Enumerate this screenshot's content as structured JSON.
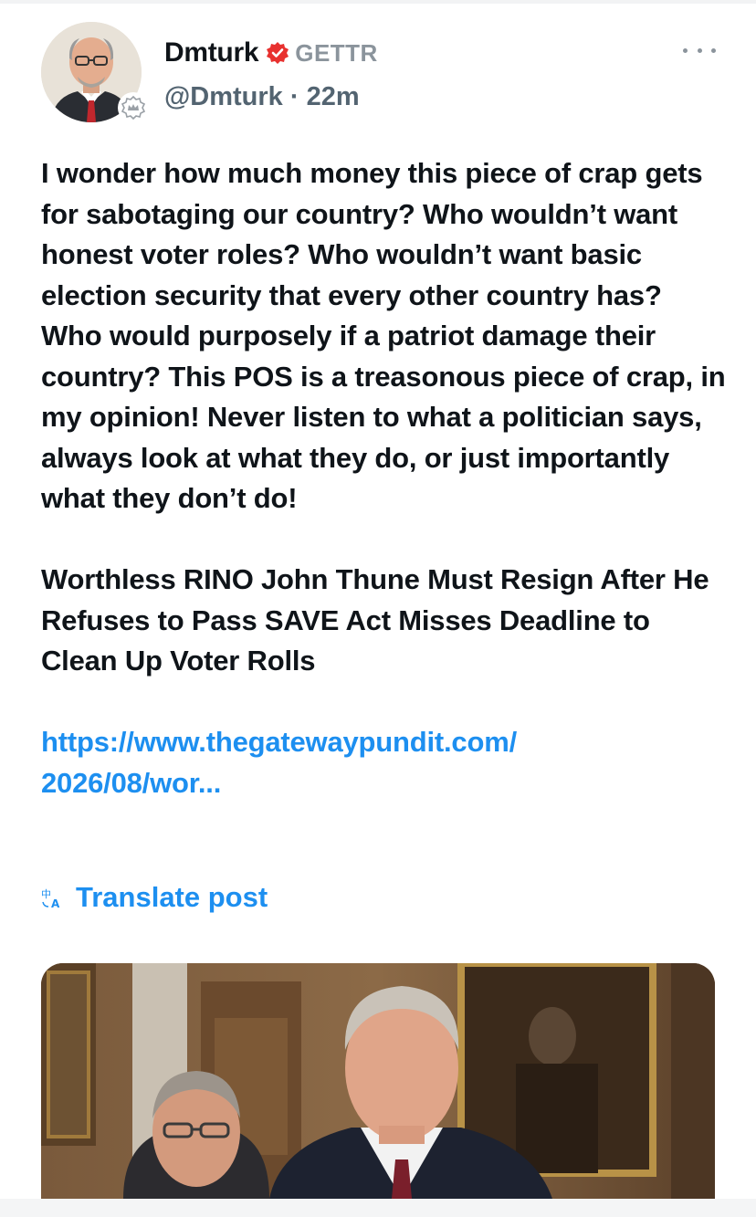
{
  "post": {
    "author": {
      "display_name": "Dmturk",
      "platform": "GETTR",
      "handle_time": "@Dmturk · 22m"
    },
    "body_paragraph": "I wonder how much money this piece of crap gets for sabotaging our country? Who wouldn’t want honest voter roles? Who wouldn’t want basic election security that every other country has? Who would purposely if a patriot damage their country? This POS is a treasonous piece of crap, in my opinion! Never listen to what a politician says, always look at what they do, or just importantly what they don’t do!",
    "headline": "Worthless RINO John Thune Must Resign After He Refuses to Pass SAVE Act Misses Deadline to Clean Up Voter Rolls",
    "link_line1": "https://www.thegatewaypundit.com/",
    "link_line2": "2026/08/wor...",
    "translate_label": "Translate post",
    "icons": {
      "verified": "verified-badge-icon",
      "more": "more-options-icon",
      "translate": "translate-icon",
      "avatar_badge": "crown-badge-icon"
    }
  },
  "colors": {
    "text": "#0f1419",
    "secondary": "#536471",
    "link": "#1d8ff0",
    "verified": "#e8312f"
  }
}
